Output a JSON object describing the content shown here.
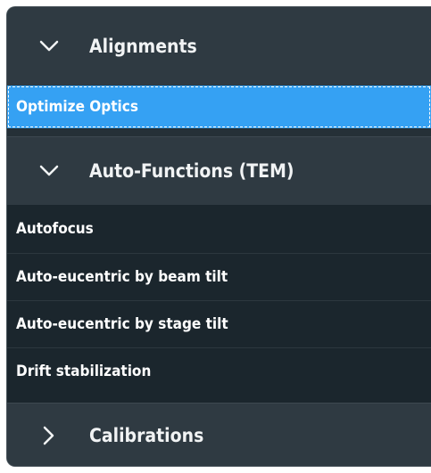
{
  "sections": [
    {
      "title": "Alignments",
      "expanded": true,
      "items": [
        "Optimize Optics"
      ],
      "selected_index": 0
    },
    {
      "title": "Auto-Functions (TEM)",
      "expanded": true,
      "items": [
        "Autofocus",
        "Auto-eucentric by beam tilt",
        "Auto-eucentric by stage tilt",
        "Drift stabilization"
      ]
    },
    {
      "title": "Calibrations",
      "expanded": false,
      "items": []
    }
  ],
  "colors": {
    "panel_bg": "#253037",
    "header_bg": "#2f3a42",
    "item_bg": "#1b262d",
    "selection": "#35a1f3",
    "text": "#ffffff"
  },
  "icons": {
    "expanded": "chevron-down-icon",
    "collapsed": "chevron-right-icon"
  }
}
